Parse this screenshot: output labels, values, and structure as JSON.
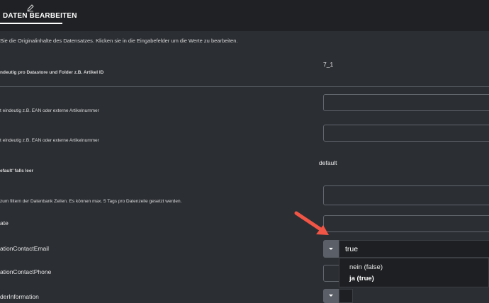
{
  "header": {
    "tab_label": "DATEN BEARBEITEN",
    "tab_icon": "pencil-icon"
  },
  "info_text": "Sie die Originalinhalte des Datensatzes. Klicken sie in die Eingabefelder um die Werte zu bearbeiten.",
  "fields": {
    "id_value": "7_1",
    "id_desc": "ndeutig pro Datastore und Folder z.B. Artikel ID",
    "ean_desc_1": "t eindeutig z.B. EAN oder externe Artikelnummer",
    "ean_desc_2": "t eindeutig z.B. EAN oder externe Artikelnummer",
    "default_value": "default",
    "default_desc": "efault' falls leer",
    "tags_desc": "zum filtern der Datenbank Zeilen. Es können max. 5 Tags pro Datenzeile gesetzt werden.",
    "date_label": "ate",
    "email_label": "ationContactEmail",
    "phone_label": "ationContactPhone",
    "holder_label": "derInformation"
  },
  "select": {
    "value": "true",
    "options": [
      "nein (false)",
      "ja (true)"
    ],
    "selected_index": 1
  },
  "colors": {
    "background": "#2b2e33",
    "topbar": "#1f2124",
    "arrow": "#f05545"
  }
}
